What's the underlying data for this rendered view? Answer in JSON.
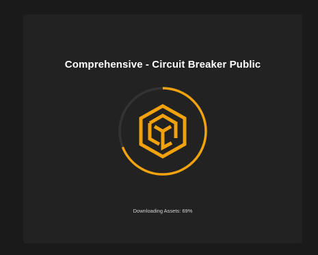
{
  "app": {
    "title": "Comprehensive - Circuit Breaker Public"
  },
  "loader": {
    "icon": "cube-logo-icon",
    "progress_fraction": 0.69,
    "status_text": "Downloading Assets: 69%"
  },
  "colors": {
    "background": "#1a1a1a",
    "panel": "#222222",
    "accent": "#f2a20c",
    "track": "#333333"
  }
}
